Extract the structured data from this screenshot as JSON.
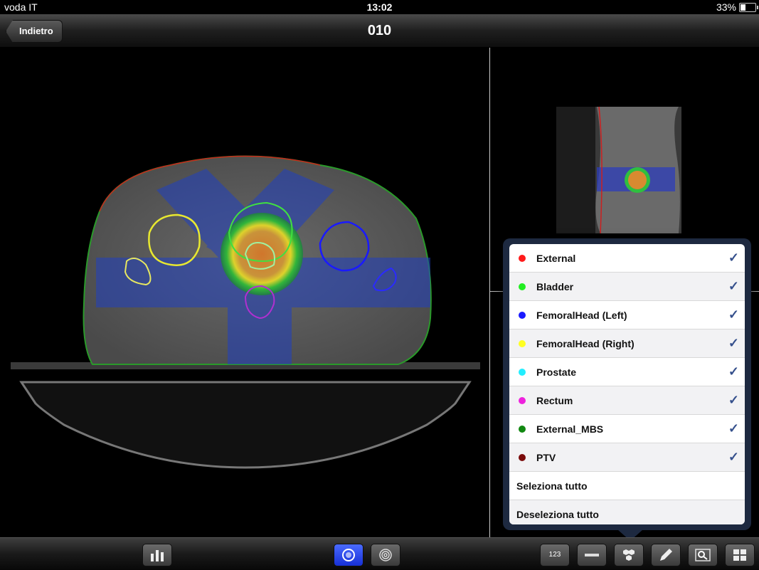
{
  "status": {
    "carrier": "voda IT",
    "time": "13:02",
    "battery": "33%"
  },
  "nav": {
    "back_label": "Indietro",
    "title": "010"
  },
  "structures": [
    {
      "label": "External",
      "color": "#ff1a1a",
      "checked": true
    },
    {
      "label": "Bladder",
      "color": "#22ee22",
      "checked": true
    },
    {
      "label": "FemoralHead (Left)",
      "color": "#1a1aff",
      "checked": true
    },
    {
      "label": "FemoralHead (Right)",
      "color": "#ffff22",
      "checked": true
    },
    {
      "label": "Prostate",
      "color": "#22eeff",
      "checked": true
    },
    {
      "label": "Rectum",
      "color": "#ee22dd",
      "checked": true
    },
    {
      "label": "External_MBS",
      "color": "#118811",
      "checked": true
    },
    {
      "label": "PTV",
      "color": "#7a0a0a",
      "checked": true
    }
  ],
  "actions": {
    "select_all": "Seleziona tutto",
    "deselect_all": "Deseleziona tutto"
  },
  "toolbar": {
    "numbers_label": "123"
  },
  "check_glyph": "✓"
}
